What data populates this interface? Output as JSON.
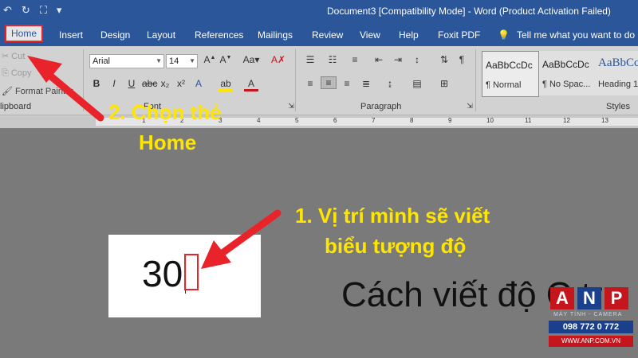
{
  "titlebar": {
    "title": "Document3 [Compatibility Mode] - Word (Product Activation Failed)",
    "qat_icons": [
      "undo-icon",
      "redo-icon",
      "touch-mode-icon",
      "customize-qat-icon"
    ]
  },
  "tabs": [
    {
      "label": "Home",
      "selected": true
    },
    {
      "label": "Insert"
    },
    {
      "label": "Design"
    },
    {
      "label": "Layout"
    },
    {
      "label": "References"
    },
    {
      "label": "Mailings"
    },
    {
      "label": "Review"
    },
    {
      "label": "View"
    },
    {
      "label": "Help"
    },
    {
      "label": "Foxit PDF"
    }
  ],
  "tell_me": "Tell me what you want to do",
  "ribbon": {
    "clipboard": {
      "cut": "Cut",
      "copy": "Copy",
      "format_painter": "Format Painter",
      "label": "lipboard"
    },
    "font": {
      "name": "Arial",
      "size": "14",
      "label": "Font"
    },
    "paragraph": {
      "label": "Paragraph"
    },
    "styles": {
      "label": "Styles",
      "items": [
        {
          "sample": "AaBbCcDc",
          "name": "¶ Normal"
        },
        {
          "sample": "AaBbCcDc",
          "name": "¶ No Spac..."
        },
        {
          "sample": "AaBbCc",
          "name": "Heading 1"
        }
      ]
    }
  },
  "document": {
    "snippet_text": "30",
    "heading_text": "Cách viết độ C tr"
  },
  "annotations": {
    "step2_line1": "2. Chọn thẻ",
    "step2_line2": "Home",
    "step1_line1": "1. Vị trí mình sẽ viết",
    "step1_line2": "biểu tượng độ"
  },
  "logo": {
    "letters": [
      "A",
      "N",
      "P"
    ],
    "tagline": "MÁY TÍNH - CAMERA",
    "phone": "098 772 0 772",
    "website": "WWW.ANP.COM.VN"
  },
  "colors": {
    "title_blue": "#2b579a",
    "highlight_red": "#e8242a",
    "annotation_yellow": "#ffe600"
  }
}
